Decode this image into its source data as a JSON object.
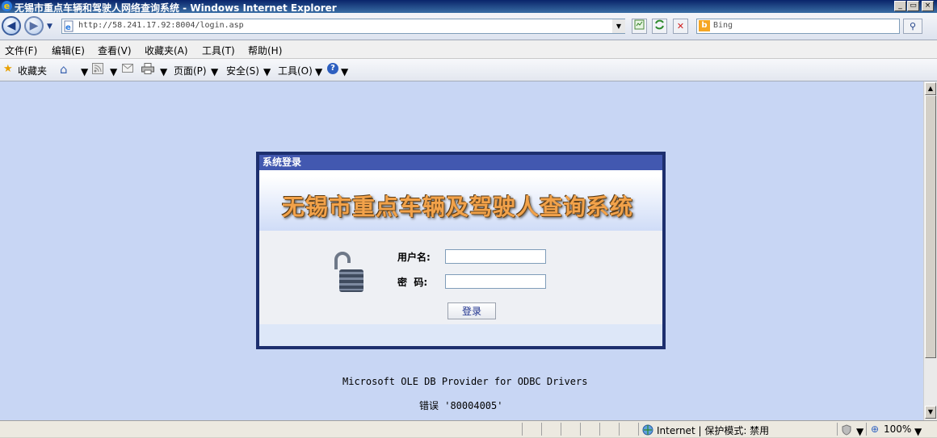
{
  "window": {
    "title": "无锡市重点车辆和驾驶人网络查询系统 - Windows Internet Explorer",
    "controls": {
      "minimize": "_",
      "restore": "▭",
      "close": "×"
    }
  },
  "address_bar": {
    "url": "http://58.241.17.92:8004/login.asp"
  },
  "search_box": {
    "placeholder": "Bing"
  },
  "menu": {
    "items": [
      "文件(F)",
      "编辑(E)",
      "查看(V)",
      "收藏夹(A)",
      "工具(T)",
      "帮助(H)"
    ]
  },
  "favorites_bar": {
    "favorites_label": "收藏夹",
    "page_label": "页面(P)",
    "safety_label": "安全(S)",
    "tools_label": "工具(O)"
  },
  "login_panel": {
    "header": "系统登录",
    "banner_title": "无锡市重点车辆及驾驶人查询系统",
    "username_label": "用户名:",
    "username_value": "",
    "password_label": "密  码:",
    "password_value": "",
    "submit_label": "登录"
  },
  "error": {
    "provider": "Microsoft OLE DB Provider for ODBC Drivers",
    "message": "错误 '80004005'"
  },
  "status_bar": {
    "zone": "Internet | 保护模式: 禁用",
    "zoom": "100%"
  },
  "colors": {
    "content_background": "#c8d6f4",
    "panel_header": "#4258b0",
    "panel_border": "#1d2f6e",
    "banner_text": "#f2a24a"
  }
}
